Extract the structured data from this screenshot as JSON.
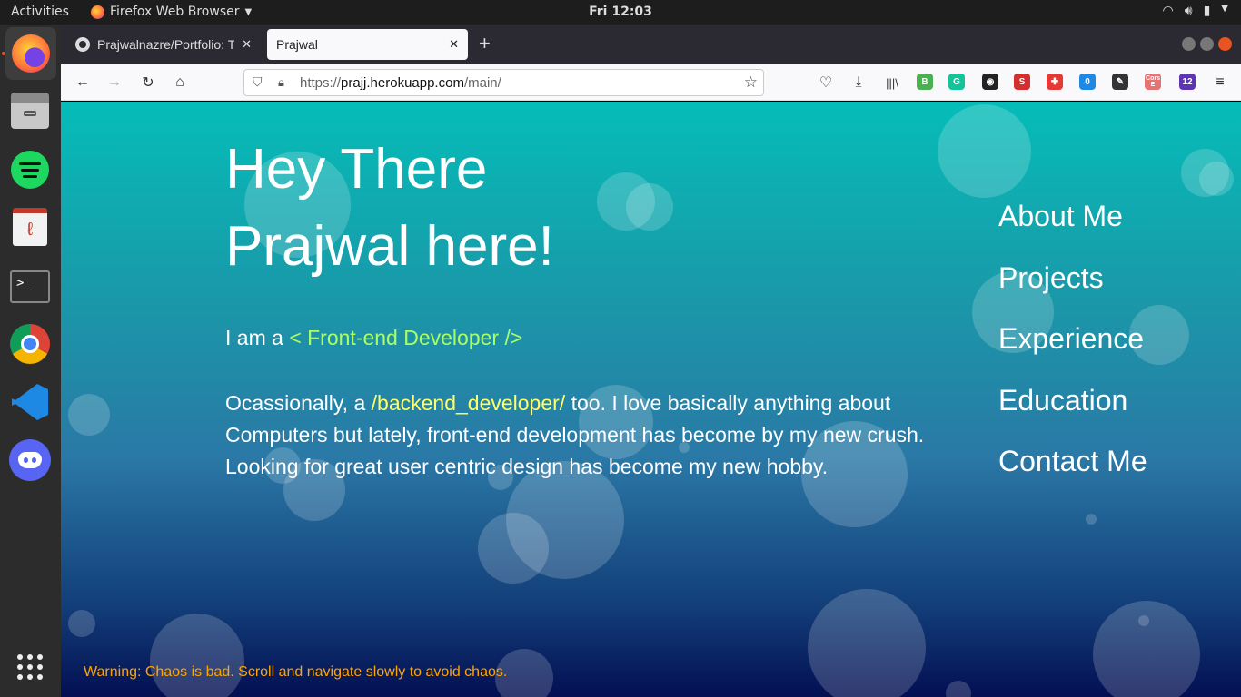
{
  "topbar": {
    "activities": "Activities",
    "app_name": "Firefox Web Browser",
    "clock": "Fri 12:03"
  },
  "dock": [
    "firefox-icon",
    "files-icon",
    "spotify-icon",
    "document-viewer-icon",
    "terminal-icon",
    "chrome-icon",
    "vscode-icon",
    "discord-icon",
    "app-grid-icon"
  ],
  "tabs": [
    {
      "title": "Prajwalnazre/Portfolio: T",
      "active": false
    },
    {
      "title": "Prajwal",
      "active": true
    }
  ],
  "url": {
    "scheme": "https://",
    "host": "prajj.herokuapp.com",
    "path": "/main/"
  },
  "extensions": [
    {
      "name": "b-ext-icon",
      "label": "B",
      "color": "#4caf50"
    },
    {
      "name": "grammarly-icon",
      "label": "G",
      "color": "#15c39a"
    },
    {
      "name": "colorzilla-icon",
      "label": "◉",
      "color": "#222"
    },
    {
      "name": "s-ext-icon",
      "label": "S",
      "color": "#d32f2f"
    },
    {
      "name": "cross-ext-icon",
      "label": "✚",
      "color": "#e53935"
    },
    {
      "name": "badge-ext-icon",
      "label": "0",
      "color": "#1e88e5"
    },
    {
      "name": "evernote-icon",
      "label": "✎",
      "color": "#333"
    },
    {
      "name": "cors-ext-icon",
      "label": "Cors E",
      "color": "#e57373"
    },
    {
      "name": "diamond-ext-icon",
      "label": "12",
      "color": "#5e35b1"
    }
  ],
  "hero": {
    "line1": "Hey There",
    "line2": "Prajwal here!"
  },
  "intro": {
    "prefix": "I am a ",
    "role": "< Front-end Developer />"
  },
  "bio": {
    "p1": "Ocassionally, a ",
    "hl": "/backend_developer/",
    "p2": " too. I love basically anything about Computers but lately, front-end development has become by my new crush. Looking for great user centric design has become my new hobby."
  },
  "menu": [
    "About Me",
    "Projects",
    "Experience",
    "Education",
    "Contact Me"
  ],
  "warning": "Warning: Chaos is bad. Scroll and navigate slowly to avoid chaos."
}
